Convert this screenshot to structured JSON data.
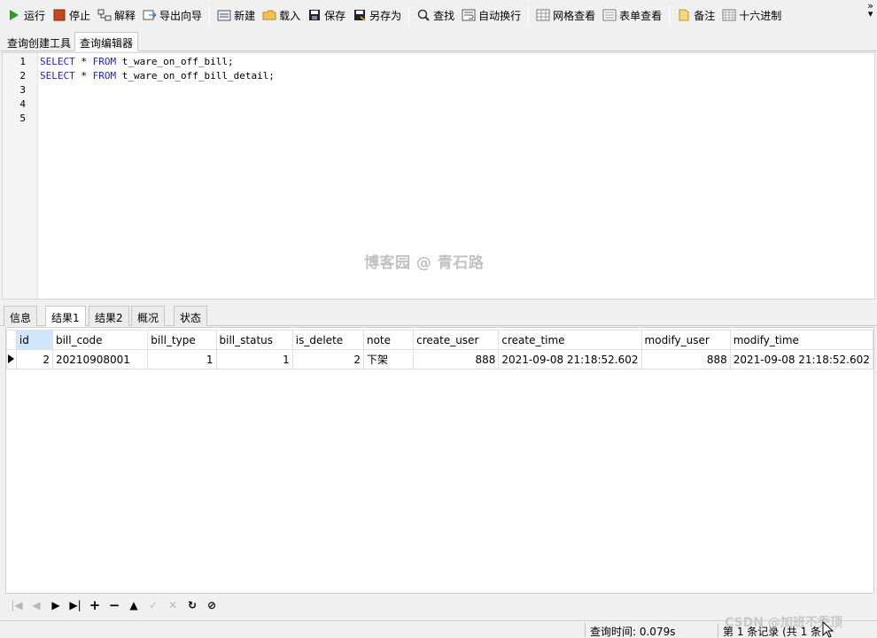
{
  "toolbar": {
    "items": [
      {
        "label": "运行",
        "icon": "play-icon"
      },
      {
        "label": "停止",
        "icon": "stop-icon"
      },
      {
        "label": "解释",
        "icon": "explain-icon"
      },
      {
        "label": "导出向导",
        "icon": "export-icon"
      },
      {
        "label": "新建",
        "icon": "new-icon"
      },
      {
        "label": "载入",
        "icon": "folder-icon"
      },
      {
        "label": "保存",
        "icon": "save-icon"
      },
      {
        "label": "另存为",
        "icon": "save-as-icon"
      },
      {
        "label": "查找",
        "icon": "search-icon"
      },
      {
        "label": "自动换行",
        "icon": "wrap-icon"
      },
      {
        "label": "网格查看",
        "icon": "grid-view-icon"
      },
      {
        "label": "表单查看",
        "icon": "form-view-icon"
      },
      {
        "label": "备注",
        "icon": "note-icon"
      },
      {
        "label": "十六进制",
        "icon": "hex-icon"
      }
    ]
  },
  "editor_tabs": [
    "查询创建工具",
    "查询编辑器"
  ],
  "editor": {
    "line_numbers": [
      "1",
      "2",
      "3",
      "4",
      "5"
    ],
    "lines": [
      {
        "kw1": "SELECT",
        "mid": " * ",
        "kw2": "FROM",
        "rest": " t_ware_on_off_bill;"
      },
      {
        "kw1": "SELECT",
        "mid": " * ",
        "kw2": "FROM",
        "rest": " t_ware_on_off_bill_detail;"
      }
    ],
    "watermark": "博客园 @ 青石路"
  },
  "result_tabs": [
    "信息",
    "结果1",
    "结果2",
    "概况",
    "状态"
  ],
  "grid": {
    "columns": [
      "id",
      "bill_code",
      "bill_type",
      "bill_status",
      "is_delete",
      "note",
      "create_user",
      "create_time",
      "modify_user",
      "modify_time"
    ],
    "rows": [
      [
        "2",
        "20210908001",
        "1",
        "1",
        "2",
        "下架",
        "888",
        "2021-09-08 21:18:52.602",
        "888",
        "2021-09-08 21:18:52.602"
      ]
    ]
  },
  "status": {
    "query_time": "查询时间: 0.079s",
    "records": "第 1 条记录 (共 1 条",
    "csdn": "CSDN @加班不秃顶"
  },
  "colors": {
    "keyword": "#1a1aff",
    "selected_header": "#cfe6fb"
  }
}
